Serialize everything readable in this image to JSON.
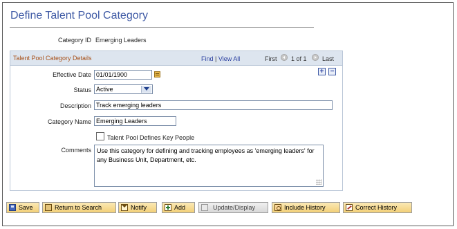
{
  "page": {
    "title": "Define Talent Pool Category"
  },
  "category_id": {
    "label": "Category ID",
    "value": "Emerging Leaders"
  },
  "details": {
    "title": "Talent Pool Category Details",
    "nav": {
      "find": "Find",
      "separator": "|",
      "view_all": "View All",
      "first": "First",
      "range": "1 of 1",
      "last": "Last"
    },
    "add_row": "+",
    "delete_row": "−",
    "effective_date": {
      "label": "Effective Date",
      "value": "01/01/1900"
    },
    "status": {
      "label": "Status",
      "value": "Active"
    },
    "description": {
      "label": "Description",
      "value": "Track emerging leaders"
    },
    "category_name": {
      "label": "Category Name",
      "value": "Emerging Leaders"
    },
    "key_people": {
      "label": "Talent Pool Defines Key People",
      "checked": false
    },
    "comments": {
      "label": "Comments",
      "value": "Use this category for defining and tracking employees as 'emerging leaders' for any Business Unit, Department, etc."
    }
  },
  "toolbar": {
    "save": "Save",
    "return_to_search": "Return to Search",
    "notify": "Notify",
    "add": "Add",
    "update_display": "Update/Display",
    "include_history": "Include History",
    "correct_history": "Correct History"
  },
  "colors": {
    "title": "#3f5aa5",
    "group_title": "#a8521b",
    "group_header_bg": "#dde5ef",
    "link": "#2a3fa0",
    "button_bg": "#f2cf78"
  },
  "icons": {
    "calendar": "calendar-icon",
    "select_arrow": "chevron-down-icon",
    "nav_prev": "previous-arrow-icon",
    "nav_next": "next-arrow-icon",
    "save": "save-icon",
    "return_to_search": "search-icon",
    "notify": "notify-icon",
    "add": "add-icon",
    "update_display": "update-icon",
    "include_history": "include-history-icon",
    "correct_history": "correct-history-icon"
  }
}
